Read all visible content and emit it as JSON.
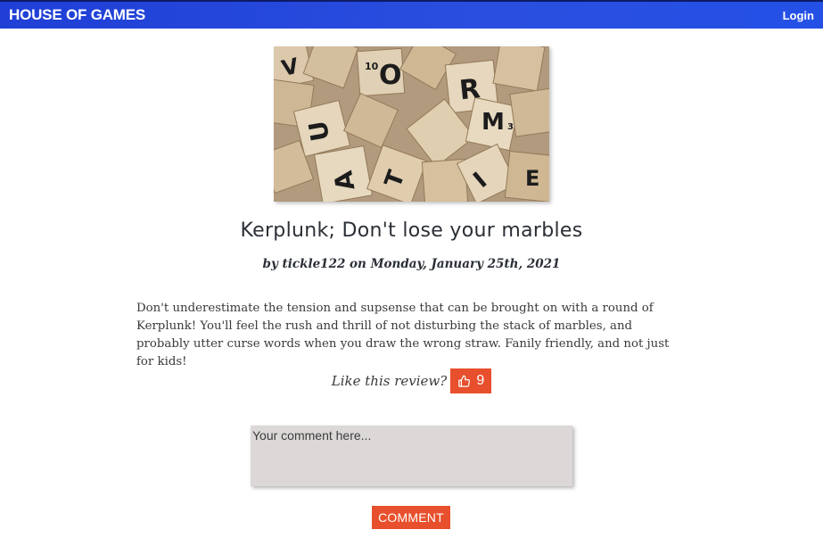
{
  "navbar": {
    "brand": "HOUSE OF GAMES",
    "login_label": "Login",
    "gradient_start": "#1f3fd6",
    "gradient_end": "#2450e6"
  },
  "review": {
    "title": "Kerplunk; Don't lose your marbles",
    "byline": "by tickle122 on Monday, January 25th, 2021",
    "body": "Don't underestimate the tension and supsense that can be brought on with a round of Kerplunk! You'll feel the rush and thrill of not disturbing the stack of marbles, and probably utter curse words when you draw the wrong straw. Fanily friendly, and not just for kids!",
    "image_icon": "scrabble-tiles-photo"
  },
  "votes": {
    "prompt": "Like this review?",
    "count": "9",
    "icon": "thumbs-up-icon"
  },
  "comment": {
    "placeholder": "Your comment here...",
    "submit_label": "COMMENT"
  },
  "colors": {
    "accent": "#e84f2c",
    "comment_bg": "#dcd8d8"
  }
}
